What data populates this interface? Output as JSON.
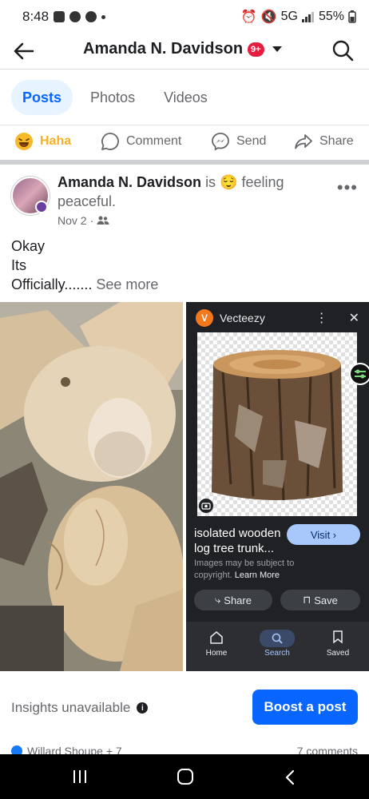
{
  "status_bar": {
    "time": "8:48",
    "network": "5G",
    "battery": "55%"
  },
  "header": {
    "back_icon": "arrow-left-icon",
    "title": "Amanda N. Davidson",
    "notification_badge": "9+",
    "search_icon": "search-icon"
  },
  "tabs": [
    {
      "label": "Posts",
      "active": true
    },
    {
      "label": "Photos",
      "active": false
    },
    {
      "label": "Videos",
      "active": false
    }
  ],
  "action_row": {
    "haha": "Haha",
    "comment": "Comment",
    "send": "Send",
    "share": "Share"
  },
  "post": {
    "author": "Amanda N. Davidson",
    "status_prefix": "is",
    "feeling": "feeling peaceful.",
    "date": "Nov 2",
    "audience_icon": "friends-icon",
    "text_lines": [
      "Okay",
      "Its",
      "Officially......."
    ],
    "see_more": "See more"
  },
  "right_image": {
    "source": "Vecteezy",
    "caption": "isolated wooden log tree trunk...",
    "visit_label": "Visit",
    "copyright_text": "Images may be subject to copyright.",
    "learn_more": "Learn More",
    "share_label": "Share",
    "save_label": "Save",
    "nav": {
      "home": "Home",
      "search": "Search",
      "saved": "Saved"
    }
  },
  "footer": {
    "insights": "Insights unavailable",
    "boost": "Boost a post",
    "reactions_text": "Willard Shoupe + 7",
    "comments_text": "7 comments"
  },
  "colors": {
    "accent": "#0866ff",
    "badge": "#e41e3f",
    "tab_active_bg": "#e7f3ff"
  }
}
